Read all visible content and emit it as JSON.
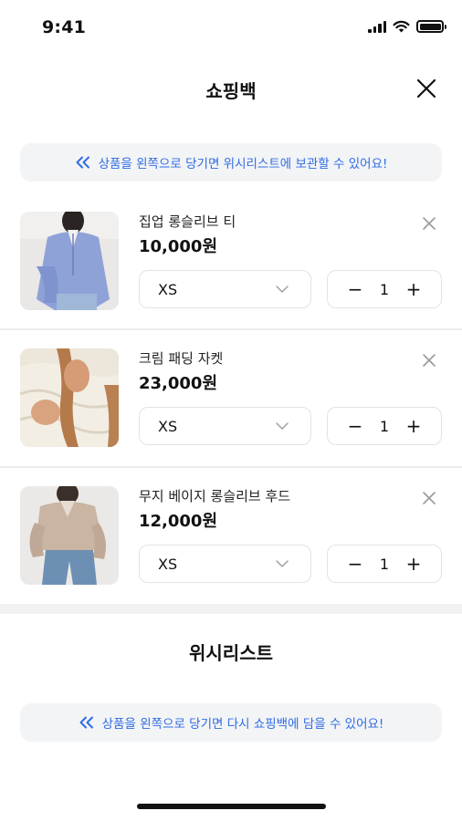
{
  "status_bar": {
    "time": "9:41"
  },
  "header": {
    "title": "쇼핑백"
  },
  "cart_hint": {
    "text": "상품을 왼쪽으로 당기면 위시리스트에 보관할 수 있어요!"
  },
  "cart_items": [
    {
      "name": "집업 롱슬리브 티",
      "price": "10,000원",
      "size": "XS",
      "quantity": "1",
      "minus": "−",
      "plus": "+"
    },
    {
      "name": "크림 패딩 자켓",
      "price": "23,000원",
      "size": "XS",
      "quantity": "1",
      "minus": "−",
      "plus": "+"
    },
    {
      "name": "무지 베이지 롱슬리브 후드",
      "price": "12,000원",
      "size": "XS",
      "quantity": "1",
      "minus": "−",
      "plus": "+"
    }
  ],
  "wishlist": {
    "title": "위시리스트",
    "hint": "상품을 왼쪽으로 당기면 다시 쇼핑백에 담을 수 있어요!"
  },
  "colors": {
    "accent": "#2f6ce5",
    "hint_bg": "#f3f4f6",
    "border": "#e3e3e3"
  }
}
